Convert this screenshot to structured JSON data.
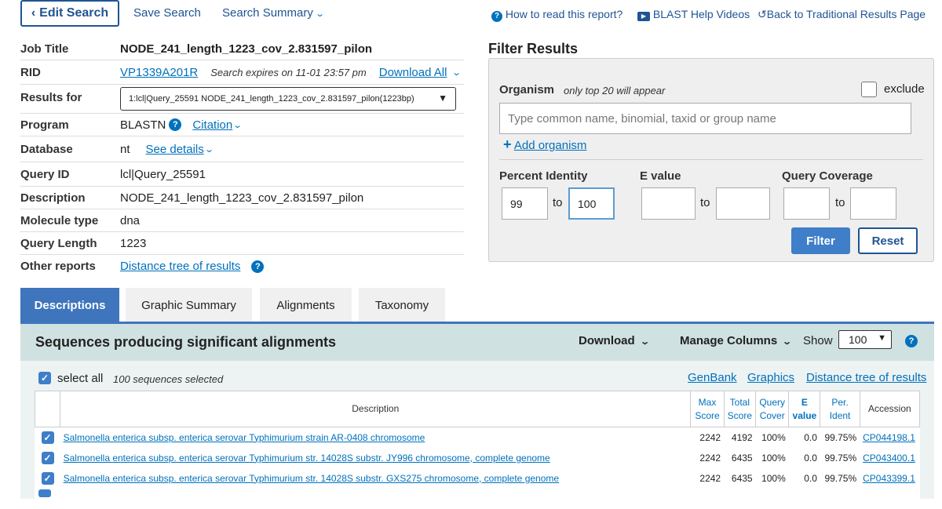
{
  "topbar": {
    "edit_search": "Edit Search",
    "save_search": "Save Search",
    "search_summary": "Search Summary",
    "how_to_read": "How to read this report?",
    "blast_help_videos": "BLAST Help Videos",
    "back_traditional": "Back to Traditional Results Page"
  },
  "job": {
    "rows": {
      "job_title": {
        "label": "Job Title",
        "value": "NODE_241_length_1223_cov_2.831597_pilon"
      },
      "rid": {
        "label": "RID",
        "value": "VP1339A201R",
        "expires": "Search expires on 11-01 23:57 pm",
        "download_all": "Download All"
      },
      "results_for": {
        "label": "Results for",
        "value": "1:lcl|Query_25591 NODE_241_length_1223_cov_2.831597_pilon(1223bp)"
      },
      "program": {
        "label": "Program",
        "value": "BLASTN",
        "citation": "Citation"
      },
      "database": {
        "label": "Database",
        "value": "nt",
        "see_details": "See details"
      },
      "query_id": {
        "label": "Query ID",
        "value": "lcl|Query_25591"
      },
      "description": {
        "label": "Description",
        "value": "NODE_241_length_1223_cov_2.831597_pilon"
      },
      "molecule_type": {
        "label": "Molecule type",
        "value": "dna"
      },
      "query_length": {
        "label": "Query Length",
        "value": "1223"
      },
      "other_reports": {
        "label": "Other reports",
        "value": "Distance tree of results"
      }
    }
  },
  "filter": {
    "title": "Filter Results",
    "organism_label": "Organism",
    "organism_hint": "only top 20 will appear",
    "exclude_label": "exclude",
    "organism_placeholder": "Type common  name, binomial, taxid or group  name",
    "add_organism": "Add organism",
    "percent_identity_label": "Percent Identity",
    "evalue_label": "E value",
    "query_coverage_label": "Query Coverage",
    "to": "to",
    "pi_from": "99",
    "pi_to": "100",
    "filter_button": "Filter",
    "reset_button": "Reset"
  },
  "tabs": [
    "Descriptions",
    "Graphic Summary",
    "Alignments",
    "Taxonomy"
  ],
  "results": {
    "title": "Sequences producing significant alignments",
    "download": "Download",
    "manage_columns": "Manage Columns",
    "show_label": "Show",
    "show_value": "100",
    "select_all": "select all",
    "selected_count": "100 sequences selected",
    "links": {
      "genbank": "GenBank",
      "graphics": "Graphics",
      "distance_tree": "Distance tree of results"
    },
    "columns": {
      "description": "Description",
      "max_score": [
        "Max",
        "Score"
      ],
      "total_score": [
        "Total",
        "Score"
      ],
      "query_cover": [
        "Query",
        "Cover"
      ],
      "evalue": [
        "E",
        "value"
      ],
      "per_ident": [
        "Per.",
        "Ident"
      ],
      "accession": "Accession"
    },
    "rows": [
      {
        "description": "Salmonella enterica subsp. enterica serovar Typhimurium strain AR-0408 chromosome",
        "max_score": "2242",
        "total_score": "4192",
        "query_cover": "100%",
        "evalue": "0.0",
        "per_ident": "99.75%",
        "accession": "CP044198.1"
      },
      {
        "description": "Salmonella enterica subsp. enterica serovar Typhimurium str. 14028S substr. JY996 chromosome, complete genome",
        "max_score": "2242",
        "total_score": "6435",
        "query_cover": "100%",
        "evalue": "0.0",
        "per_ident": "99.75%",
        "accession": "CP043400.1"
      },
      {
        "description": "Salmonella enterica subsp. enterica serovar Typhimurium str. 14028S substr. GXS275 chromosome, complete genome",
        "max_score": "2242",
        "total_score": "6435",
        "query_cover": "100%",
        "evalue": "0.0",
        "per_ident": "99.75%",
        "accession": "CP043399.1"
      }
    ]
  }
}
